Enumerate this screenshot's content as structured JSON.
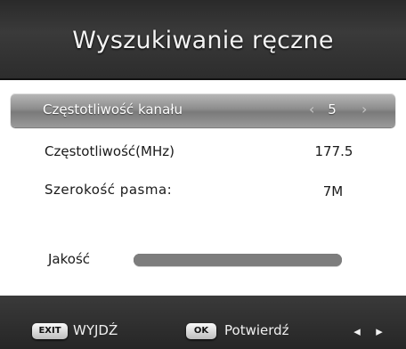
{
  "header": {
    "title": "Wyszukiwanie ręczne"
  },
  "rows": {
    "channel": {
      "label": "Częstotliwość kanału",
      "value": "5"
    },
    "frequency": {
      "label": "Częstotliwość(MHz)",
      "value": "177.5"
    },
    "bandwidth": {
      "label": "Szerokość pasma:",
      "value": "7M"
    }
  },
  "quality": {
    "label": "Jakość",
    "level": 1.0
  },
  "footer": {
    "exit_key": "EXIT",
    "exit_label": "WYJDŹ",
    "ok_key": "OK",
    "ok_label": "Potwierdź"
  },
  "icons": {
    "arrow_left": "‹",
    "arrow_right": "›",
    "nav_left": "◂",
    "nav_right": "▸"
  },
  "colors": {
    "header_bg": "#333333",
    "selection_bg": "#8d8d8d",
    "footer_bg": "#2e2e2e",
    "quality_bar": "#7d7d7d"
  }
}
